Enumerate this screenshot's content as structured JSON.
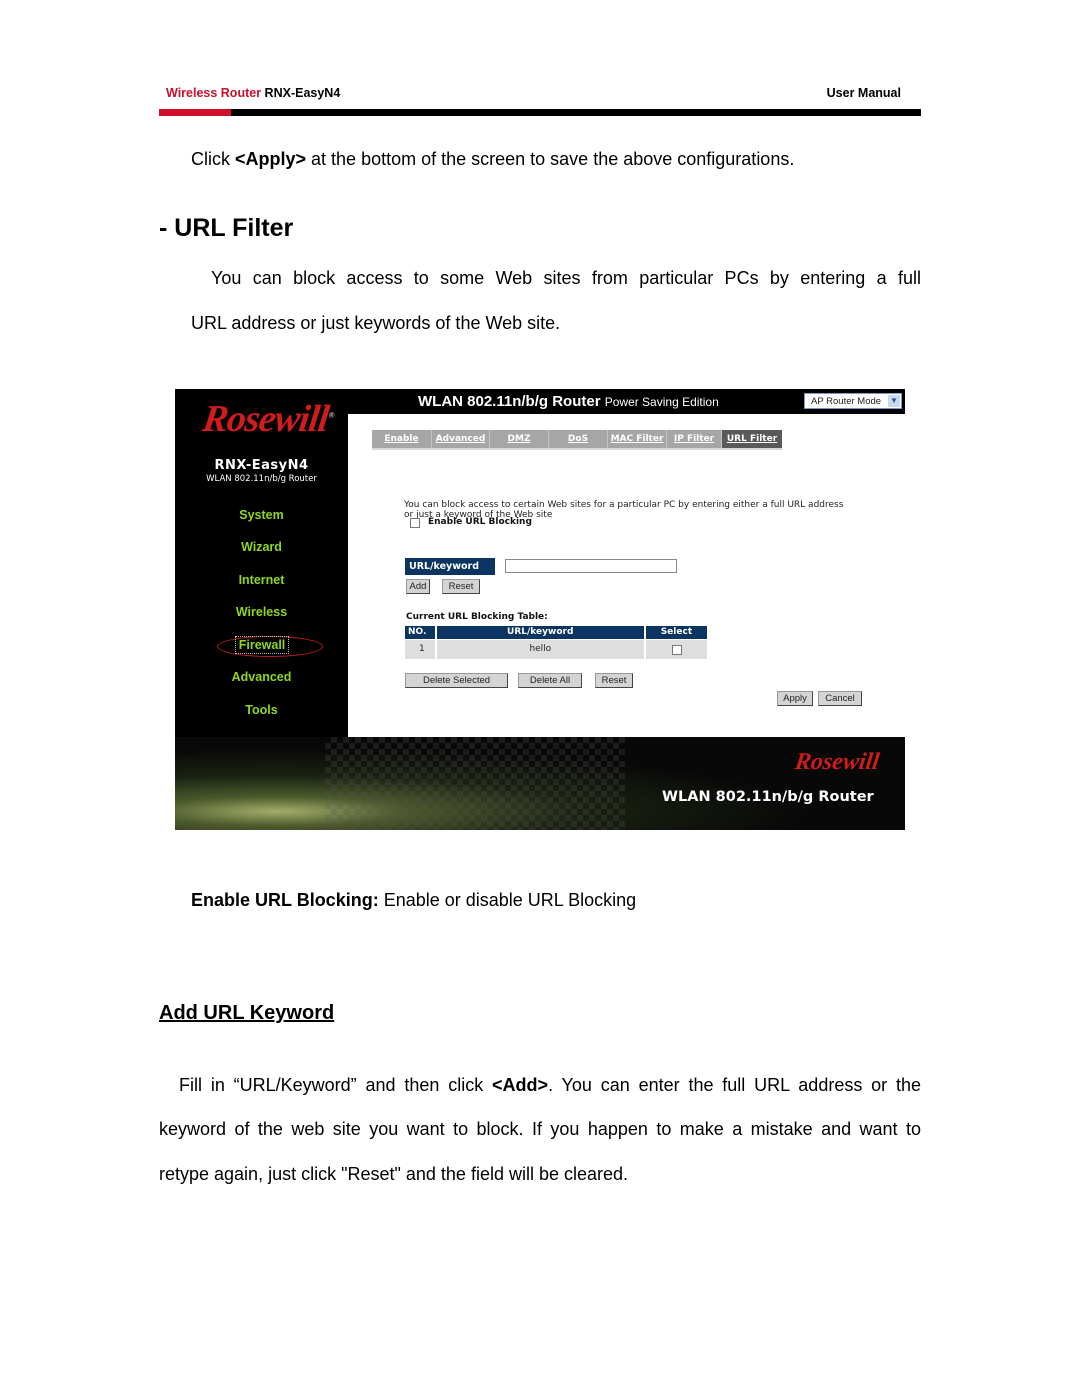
{
  "header": {
    "brand": "Wireless Router",
    "model": "RNX-EasyN4",
    "doc_type": "User Manual",
    "accent_color": "#d0102a"
  },
  "body": {
    "apply_prefix": "Click ",
    "apply_bold": "<Apply>",
    "apply_suffix": " at the bottom of the screen to save the above configurations.",
    "section_title": "- URL Filter",
    "intro_line1": "You can block access to some Web sites from particular PCs by entering a full",
    "intro_line2": "URL address or just keywords of the Web site.",
    "enable_bold": "Enable URL Blocking:",
    "enable_text": " Enable or disable URL Blocking",
    "subsection_title": "Add URL Keyword",
    "fill_line1_prefix": "Fill in “URL/Keyword” and then click ",
    "fill_line1_bold": "<Add>",
    "fill_line1_suffix": ". You can enter the full URL address or the",
    "fill_line2": "keyword of the web site you want to block. If you happen to make a mistake and want to",
    "fill_line3": "retype again, just click \"Reset\" and the field will be cleared."
  },
  "router_ui": {
    "logo": "Rosewill",
    "model": "RNX-EasyN4",
    "model_sub": "WLAN 802.11n/b/g Router",
    "title": "WLAN 802.11n/b/g Router",
    "title_small": "Power Saving Edition",
    "mode_select": "AP Router Mode",
    "nav": [
      {
        "label": "System"
      },
      {
        "label": "Wizard"
      },
      {
        "label": "Internet"
      },
      {
        "label": "Wireless"
      },
      {
        "label": "Firewall",
        "active": true
      },
      {
        "label": "Advanced"
      },
      {
        "label": "Tools"
      }
    ],
    "tabs": [
      {
        "label": "Enable"
      },
      {
        "label": "Advanced"
      },
      {
        "label": "DMZ"
      },
      {
        "label": "DoS"
      },
      {
        "label": "MAC Filter"
      },
      {
        "label": "IP Filter"
      },
      {
        "label": "URL Filter",
        "active": true
      }
    ],
    "description": "You can block access to certain Web sites for a particular PC by entering either a full URL address or just a keyword of the Web site",
    "enable_label": "Enable URL Blocking",
    "enable_checked": false,
    "keyword_label": "URL/keyword",
    "keyword_value": "",
    "add_button": "Add",
    "reset_button": "Reset",
    "table_title": "Current URL Blocking Table:",
    "table_headers": [
      "NO.",
      "URL/keyword",
      "Select"
    ],
    "table_rows": [
      {
        "no": "1",
        "keyword": "hello",
        "selected": false
      }
    ],
    "delete_selected_button": "Delete Selected",
    "delete_all_button": "Delete All",
    "table_reset_button": "Reset",
    "apply_button": "Apply",
    "cancel_button": "Cancel",
    "footer_logo": "Rosewill",
    "footer_title": "WLAN 802.11n/b/g Router"
  }
}
